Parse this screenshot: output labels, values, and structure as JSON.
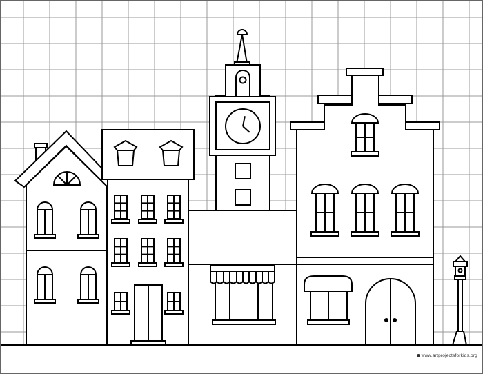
{
  "footer": {
    "credit_text": "www.artprojectsforkids.org"
  },
  "colors": {
    "line": "#000000",
    "grid": "#999999",
    "paper": "#ffffff"
  },
  "clock": {
    "hour": 12,
    "minute": 22
  }
}
